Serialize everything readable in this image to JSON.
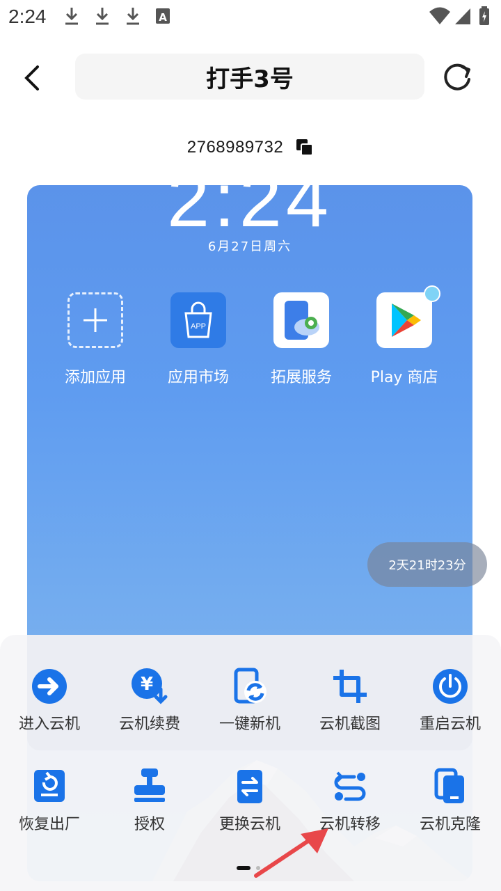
{
  "status_bar": {
    "time": "2:24"
  },
  "header": {
    "title": "打手3号"
  },
  "device": {
    "id": "2768989732"
  },
  "preview": {
    "clock": "2:24",
    "date": "6月27日周六",
    "apps": [
      {
        "label": "添加应用",
        "icon": "add-app-icon"
      },
      {
        "label": "应用市场",
        "icon": "app-market-icon",
        "badge": "APP"
      },
      {
        "label": "拓展服务",
        "icon": "extension-service-icon"
      },
      {
        "label": "Play 商店",
        "icon": "play-store-icon"
      }
    ],
    "remaining_time": "2天21时23分"
  },
  "actions_row1": [
    {
      "label": "进入云机"
    },
    {
      "label": "云机续费"
    },
    {
      "label": "一键新机"
    },
    {
      "label": "云机截图"
    },
    {
      "label": "重启云机"
    }
  ],
  "actions_row2": [
    {
      "label": "恢复出厂"
    },
    {
      "label": "授权"
    },
    {
      "label": "更换云机"
    },
    {
      "label": "云机转移"
    },
    {
      "label": "云机克隆"
    }
  ],
  "colors": {
    "accent": "#1a73e8",
    "preview_bg": "#5f9cf0",
    "annotation": "#e8474a"
  }
}
